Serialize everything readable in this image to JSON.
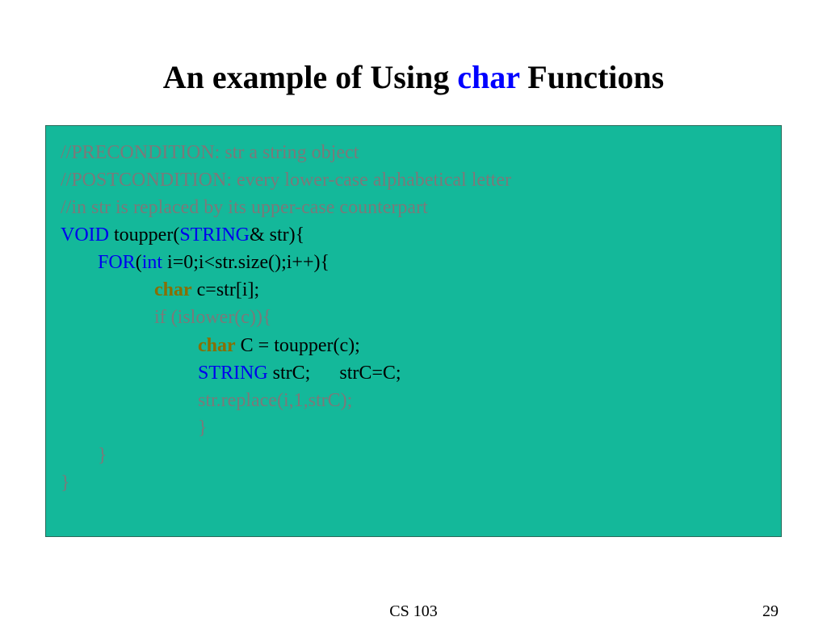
{
  "title": {
    "part1": "An example of Using ",
    "highlight": "char",
    "part2": " Functions"
  },
  "code": {
    "comment1": "//PRECONDITION: str a string object",
    "comment2": "//POSTCONDITION: every lower-case alphabetical letter",
    "comment3": "//in str is replaced by its upper-case counterpart",
    "l4_kw1": "VOID",
    "l4_mid": " toupper(",
    "l4_kw2": "STRING",
    "l4_end": "& str){",
    "l5_kw1": "FOR",
    "l5_a": "(",
    "l5_kw2": "int",
    "l5_end": " i=0;i<str.size();i++){",
    "l6_type": "char",
    "l6_end": " c=str[i];",
    "l7": "if (islower(c)){",
    "l8_type": "char",
    "l8_end": " C = toupper(c);",
    "l9_kw": "STRING",
    "l9_end": " strC;      strC=C;",
    "l10": "str.replace(i,1,strC);",
    "l11": "}",
    "l12": "}",
    "l13": "}"
  },
  "footer": {
    "center": "CS 103",
    "page": "29"
  }
}
